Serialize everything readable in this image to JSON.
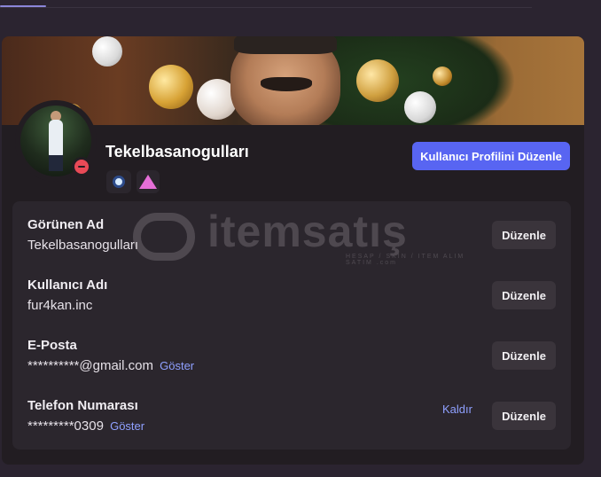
{
  "user": {
    "username": "Tekelbasanogulları",
    "status": "dnd",
    "status_color": "#e84a57"
  },
  "header": {
    "edit_profile_label": "Kullanıcı Profilini Düzenle",
    "accent_color": "#5865f2"
  },
  "badges": [
    {
      "name": "hypesquad-badge-icon"
    },
    {
      "name": "triangle-badge-icon",
      "color": "#e66fd8"
    }
  ],
  "fields": {
    "display_name": {
      "label": "Görünen Ad",
      "value": "Tekelbasanogulları",
      "edit_label": "Düzenle"
    },
    "username": {
      "label": "Kullanıcı Adı",
      "value": "fur4kan.inc",
      "edit_label": "Düzenle"
    },
    "email": {
      "label": "E-Posta",
      "value": "**********@gmail.com",
      "reveal_label": "Göster",
      "edit_label": "Düzenle"
    },
    "phone": {
      "label": "Telefon Numarası",
      "value": "*********0309",
      "reveal_label": "Göster",
      "remove_label": "Kaldır",
      "edit_label": "Düzenle"
    }
  },
  "watermark": {
    "text": "itemsatış",
    "sub": "HESAP / SKIN / ITEM ALIM SATIM",
    "suffix": ".com"
  }
}
